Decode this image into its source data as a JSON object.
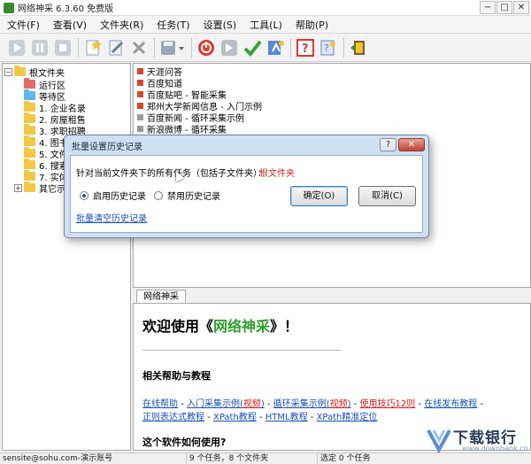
{
  "window": {
    "title": "网络神采 6.3.60 免费版",
    "minimize_glyph": "−",
    "maximize_glyph": "□",
    "close_glyph": "✕"
  },
  "menu": [
    {
      "label": "文件(F)"
    },
    {
      "label": "查看(V)"
    },
    {
      "label": "文件夹(R)"
    },
    {
      "label": "任务(T)"
    },
    {
      "label": "设置(S)"
    },
    {
      "label": "工具(L)"
    },
    {
      "label": "帮助(P)"
    }
  ],
  "toolbar": {
    "buttons": [
      {
        "icon": "play-icon",
        "color": "#9aa3ad"
      },
      {
        "icon": "pause-icon",
        "color": "#9aa3ad"
      },
      {
        "icon": "stop-icon",
        "color": "#9aa3ad"
      },
      {
        "icon": "new-task-icon",
        "color": "#d9a63a"
      },
      {
        "icon": "edit-task-icon",
        "color": "#9fb2c8"
      },
      {
        "icon": "delete-icon",
        "color": "#a0a0a0"
      },
      {
        "icon": "save-icon",
        "color": "#9aa6b6"
      },
      {
        "icon": "power-icon",
        "color": "#d93a32"
      },
      {
        "icon": "forward-icon",
        "color": "#9aa3ad"
      },
      {
        "icon": "check-icon",
        "color": "#3aa13a"
      },
      {
        "icon": "publish-icon",
        "color": "#4a78c6"
      },
      {
        "icon": "help-icon",
        "color": "#d93a32"
      },
      {
        "icon": "search-help-icon",
        "color": "#4a78c6"
      },
      {
        "icon": "exit-icon",
        "color": "#5a9a2e"
      }
    ]
  },
  "tree": {
    "root": {
      "label": "根文件夹",
      "expander": "−"
    },
    "items": [
      {
        "label": "运行区",
        "color": "#e46b6b"
      },
      {
        "label": "等待区",
        "color": "#5ab9e8"
      },
      {
        "label": "1. 企业名录",
        "color": "#f2c744"
      },
      {
        "label": "2. 房屋租售",
        "color": "#f2c744"
      },
      {
        "label": "3. 求职招聘",
        "color": "#f2c744"
      },
      {
        "label": "4. 图书信息",
        "color": "#f2c744"
      },
      {
        "label": "5. 文件",
        "color": "#f2c744"
      },
      {
        "label": "6. 搜索",
        "color": "#f2c744"
      },
      {
        "label": "7. 实体",
        "color": "#f2c744"
      },
      {
        "label": "其它示",
        "color": "#f2c744",
        "expander": "+"
      }
    ]
  },
  "tasks": [
    {
      "name": "天涯问答",
      "color": "#d8462f"
    },
    {
      "name": "百度知道",
      "color": "#d8462f"
    },
    {
      "name": "百度贴吧 - 智能采集",
      "color": "#d8462f"
    },
    {
      "name": "郑州大学新闻信息 - 入门示例",
      "color": "#d8462f"
    },
    {
      "name": "百度新闻 - 循环采集示例",
      "color": "#9a9a9a"
    },
    {
      "name": "新浪微博 - 循环采集",
      "color": "#9a9a9a"
    }
  ],
  "browser": {
    "tab": "网络神采",
    "welcome_pre": "欢迎使用《",
    "welcome_brand": "网络神采",
    "welcome_post": "》！",
    "help_heading": "相关帮助与教程",
    "line1": [
      {
        "text": "在线帮助",
        "kind": "link"
      },
      {
        "text": " - ",
        "kind": "plain"
      },
      {
        "text": "入门采集示例(",
        "kind": "link"
      },
      {
        "text": "视频",
        "kind": "red"
      },
      {
        "text": ")",
        "kind": "link"
      },
      {
        "text": " - ",
        "kind": "plain"
      },
      {
        "text": "循环采集示例(",
        "kind": "link"
      },
      {
        "text": "视频",
        "kind": "red"
      },
      {
        "text": ")",
        "kind": "link"
      },
      {
        "text": " - ",
        "kind": "plain"
      },
      {
        "text": "使用技巧12则",
        "kind": "red"
      },
      {
        "text": " - ",
        "kind": "plain"
      },
      {
        "text": "在线发布教程",
        "kind": "link"
      },
      {
        "text": " -",
        "kind": "plain"
      }
    ],
    "line2": [
      {
        "text": "正则表达式教程",
        "kind": "link"
      },
      {
        "text": " - ",
        "kind": "plain"
      },
      {
        "text": "XPath教程",
        "kind": "link"
      },
      {
        "text": " - ",
        "kind": "plain"
      },
      {
        "text": "HTML教程",
        "kind": "link"
      },
      {
        "text": " - ",
        "kind": "plain"
      },
      {
        "text": "XPath精准定位",
        "kind": "link"
      }
    ],
    "usage_heading": "这个软件如何使用?"
  },
  "dialog": {
    "title": "批量设置历史记录",
    "help_glyph": "?",
    "close_glyph": "✕",
    "prompt": "针对当前文件夹下的所有任务（包括子文件夹）：",
    "target_folder": "根文件夹",
    "radio_enable": "启用历史记录",
    "radio_disable": "禁用历史记录",
    "radio_selected": "enable",
    "ok": "确定(O)",
    "cancel": "取消(C)",
    "clear_link": "批量清空历史记录"
  },
  "status": {
    "account": "sensite@sohu.com-演示账号",
    "counts": "9 个任务，8 个文件夹",
    "selected": "选定 0 个任务"
  },
  "watermark": {
    "text": "下载银行",
    "url": "www.downbank.cn"
  }
}
